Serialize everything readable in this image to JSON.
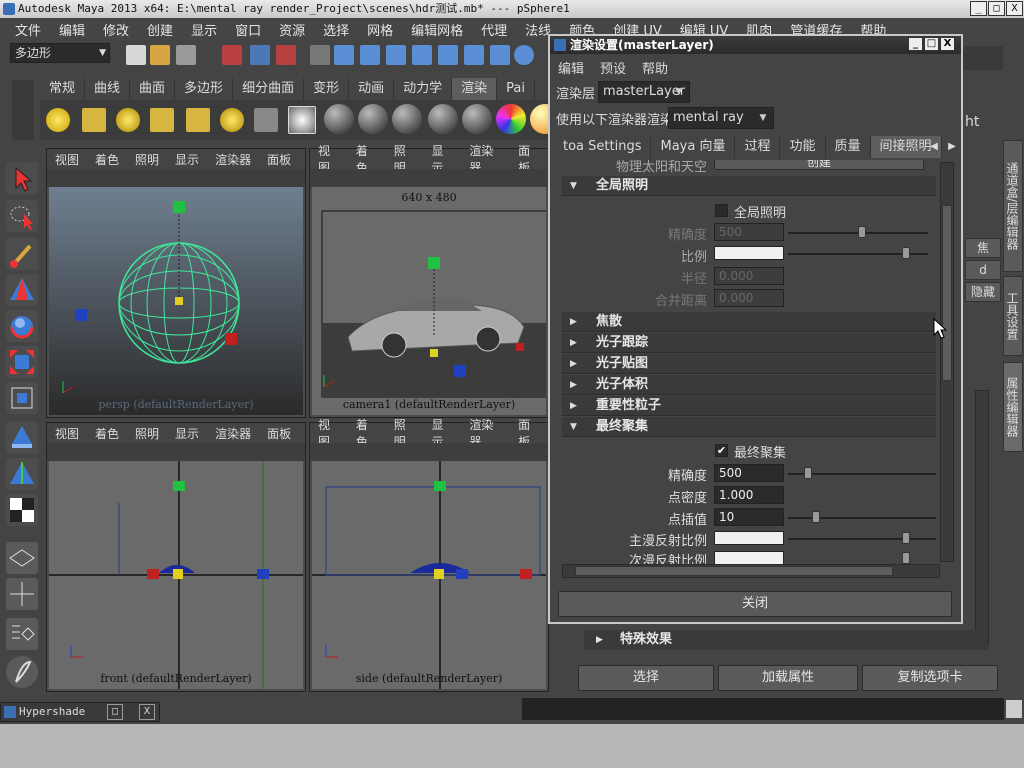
{
  "window": {
    "title": "Autodesk Maya 2013 x64: E:\\mental ray render_Project\\scenes\\hdr测试.mb*   ---   pSphere1",
    "buttons": [
      "_",
      "□",
      "X"
    ]
  },
  "menubar": [
    "文件",
    "编辑",
    "修改",
    "创建",
    "显示",
    "窗口",
    "资源",
    "选择",
    "网格",
    "编辑网格",
    "代理",
    "法线",
    "颜色",
    "创建 UV",
    "编辑 UV",
    "肌肉",
    "管道缓存",
    "帮助"
  ],
  "statusline": {
    "mode": "多边形"
  },
  "shelf": {
    "tabs": [
      "常规",
      "曲线",
      "曲面",
      "多边形",
      "细分曲面",
      "变形",
      "动画",
      "动力学",
      "渲染",
      "Pai"
    ],
    "active_tab": "渲染"
  },
  "viewports": {
    "menu": [
      "视图",
      "着色",
      "照明",
      "显示",
      "渲染器",
      "面板"
    ],
    "persp_label": "persp (defaultRenderLayer)",
    "camera_label": "camera1 (defaultRenderLayer)",
    "camera_resolution": "640 x 480",
    "front_label": "front (defaultRenderLayer)",
    "side_label": "side (defaultRenderLayer)"
  },
  "dialog": {
    "title": "渲染设置(masterLayer)",
    "buttons": [
      "_",
      "□",
      "X"
    ],
    "menu": [
      "编辑",
      "预设",
      "帮助"
    ],
    "render_layer_label": "渲染层",
    "render_layer_value": "masterLayer",
    "renderer_label": "使用以下渲染器渲染",
    "renderer_value": "mental ray",
    "tabs": [
      "toa Settings",
      "Maya 向量",
      "过程",
      "功能",
      "质量",
      "间接照明"
    ],
    "active_tab": "间接照明",
    "partial_row_label": "物理太阳和天空",
    "partial_row_button": "创建",
    "global_illum": {
      "section": "全局照明",
      "checkbox_label": "全局照明",
      "accuracy_label": "精确度",
      "accuracy_value": "500",
      "scale_label": "比例",
      "radius_label": "半径",
      "radius_value": "0.000",
      "merge_label": "合并距离",
      "merge_value": "0.000"
    },
    "collapsed_sections": [
      "焦散",
      "光子跟踪",
      "光子贴图",
      "光子体积",
      "重要性粒子"
    ],
    "final_gather": {
      "section": "最终聚集",
      "checkbox_label": "最终聚集",
      "checkbox_mark": "✔",
      "accuracy_label": "精确度",
      "accuracy_value": "500",
      "density_label": "点密度",
      "density_value": "1.000",
      "interp_label": "点插值",
      "interp_value": "10",
      "primary_label": "主漫反射比例",
      "secondary_label": "次漫反射比例"
    },
    "close_button": "关闭"
  },
  "attribute_editor": {
    "section": "特殊效果",
    "buttons": [
      "选择",
      "加载属性",
      "复制选项卡"
    ],
    "side_items": [
      "焦",
      "d",
      "隐藏",
      "属性编辑器",
      "工具设置",
      "通道盒/层编辑器"
    ],
    "partial_text": "ht"
  },
  "bottom": {
    "hypershade": "Hypershade",
    "buttons": [
      "□",
      "X"
    ]
  }
}
